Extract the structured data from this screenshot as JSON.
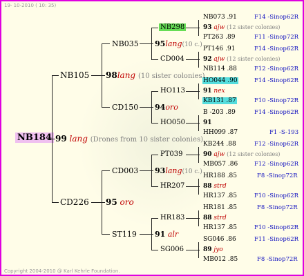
{
  "header": {
    "date": "19- 10-2010 ( 10: 35)"
  },
  "footer": {
    "copyright": "Copyright 2004-2010 @ Karl Kehrle Foundation."
  },
  "colors": {
    "frame": "#e000e0",
    "root_bg": "#f0c0f0",
    "green": "#66dd55",
    "cyan": "#55dddd",
    "red": "#c00000",
    "blue": "#1010c0"
  },
  "root": {
    "id": "NB184",
    "year": "99",
    "breeder": "lang",
    "note": "(Drones from 10 sister colonies)"
  },
  "gen1": {
    "upper": {
      "id": "NB105",
      "year": "98",
      "breeder": "lang",
      "note": "(10 sister colonies)"
    },
    "lower": {
      "id": "CD226",
      "year": "95",
      "breeder": "oro"
    }
  },
  "gen2": [
    {
      "id": "NB035",
      "year": "95",
      "breeder": "lang",
      "note": "(10 c.)"
    },
    {
      "id": "CD150",
      "year": "94",
      "breeder": "oro"
    },
    {
      "id": "CD003",
      "year": "93",
      "breeder": "lang",
      "note": "(10 c.)"
    },
    {
      "id": "ST119",
      "year": "91",
      "breeder": "alr"
    }
  ],
  "gen3": [
    {
      "id": "NB298",
      "year": "93",
      "breeder": "ajw",
      "note": "(12 sister colonies)"
    },
    {
      "id": "CD004",
      "year": "92",
      "breeder": "ajw",
      "note": "(12 sister colonies)"
    },
    {
      "id": "HO113",
      "year": "91",
      "breeder": "nex"
    },
    {
      "id": "HO050",
      "year": "91",
      "breeder": ""
    },
    {
      "id": "PT039",
      "year": "90",
      "breeder": "ajw",
      "note": "(12 sister colonies)"
    },
    {
      "id": "HR207",
      "year": "88",
      "breeder": "strd"
    },
    {
      "id": "HR183",
      "year": "88",
      "breeder": "strd"
    },
    {
      "id": "SG006",
      "year": "89",
      "breeder": "jyo"
    }
  ],
  "gen4": [
    {
      "id": "NB073",
      "yr": ".91",
      "code": "F14 -Sinop62R"
    },
    {
      "id": "PT263",
      "yr": ".89",
      "code": "F11 -Sinop72R"
    },
    {
      "id": "PT146",
      "yr": ".91",
      "code": "F14 -Sinop62R"
    },
    {
      "id": "NB114",
      "yr": ".88",
      "code": "F12 -Sinop62R"
    },
    {
      "id": "HO044",
      "yr": ".90",
      "code": "F14 -Sinop62R"
    },
    {
      "id": "KB131",
      "yr": ".87",
      "code": "F10 -Sinop72R"
    },
    {
      "id": "B -203",
      "yr": ".89",
      "code": "F14 -Sinop62R"
    },
    {
      "id": "HH099",
      "yr": ".87",
      "code": "F1 -S-193"
    },
    {
      "id": "KB244",
      "yr": ".88",
      "code": "F12 -Sinop62R"
    },
    {
      "id": "MB057",
      "yr": ".86",
      "code": "F12 -Sinop62R"
    },
    {
      "id": "HR188",
      "yr": ".85",
      "code": "F8 -Sinop72R"
    },
    {
      "id": "HR137",
      "yr": ".85",
      "code": "F10 -Sinop62R"
    },
    {
      "id": "HR181",
      "yr": ".85",
      "code": "F8 -Sinop72R"
    },
    {
      "id": "HR137",
      "yr": ".85",
      "code": "F10 -Sinop62R"
    },
    {
      "id": "SG046",
      "yr": ".86",
      "code": "F11 -Sinop62R"
    },
    {
      "id": "MB012",
      "yr": ".85",
      "code": "F8 -Sinop72R"
    }
  ]
}
